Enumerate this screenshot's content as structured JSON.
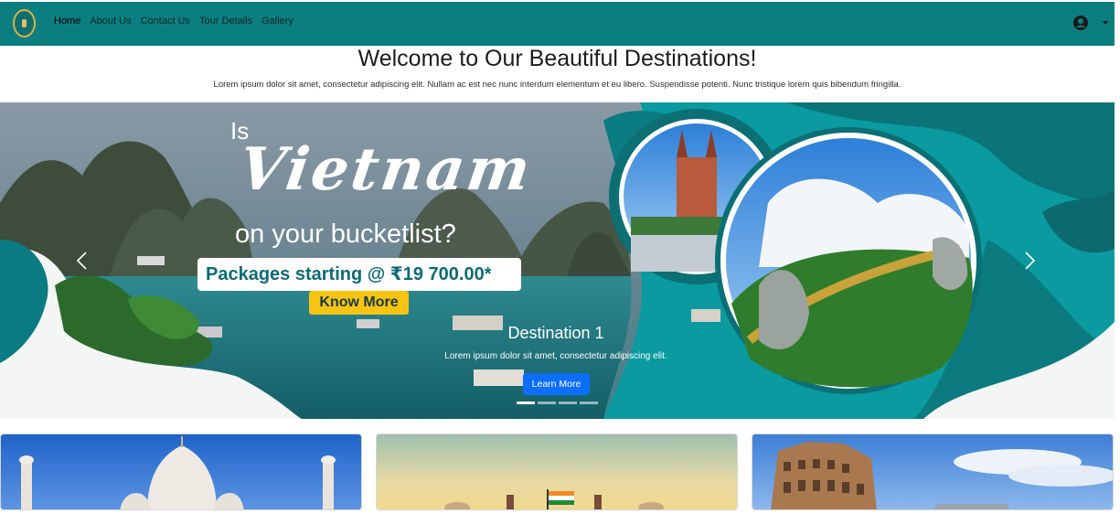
{
  "nav": {
    "links": [
      "Home",
      "About Us",
      "Contact Us",
      "Tour Details",
      "Gallery"
    ],
    "active": "Home",
    "icons": {
      "user": "user-circle-icon",
      "caret": "chevron-down-icon"
    },
    "colors": {
      "bar": "#0b7f80"
    }
  },
  "header": {
    "title": "Welcome to Our Beautiful Destinations!",
    "subtitle": "Lorem ipsum dolor sit amet, consectetur adipiscing elit. Nullam ac est nec nunc interdum elementum et eu libero. Suspendisse potenti. Nunc tristique lorem quis bibendum fringilla."
  },
  "carousel": {
    "banner": {
      "line1": "Is",
      "line2": "Vietnam",
      "line3": "on your bucketlist?",
      "package": "Packages starting @ ₹19 700.00*",
      "cta": "Know More"
    },
    "caption": {
      "title": "Destination 1",
      "text": "Lorem ipsum dolor sit amet, consectetur adipiscing elit.",
      "button": "Learn More"
    },
    "slide_count": 4,
    "active_index": 0
  },
  "cards": [
    {
      "image": "taj-mahal-image"
    },
    {
      "image": "india-gate-image"
    },
    {
      "image": "colosseum-image"
    }
  ]
}
